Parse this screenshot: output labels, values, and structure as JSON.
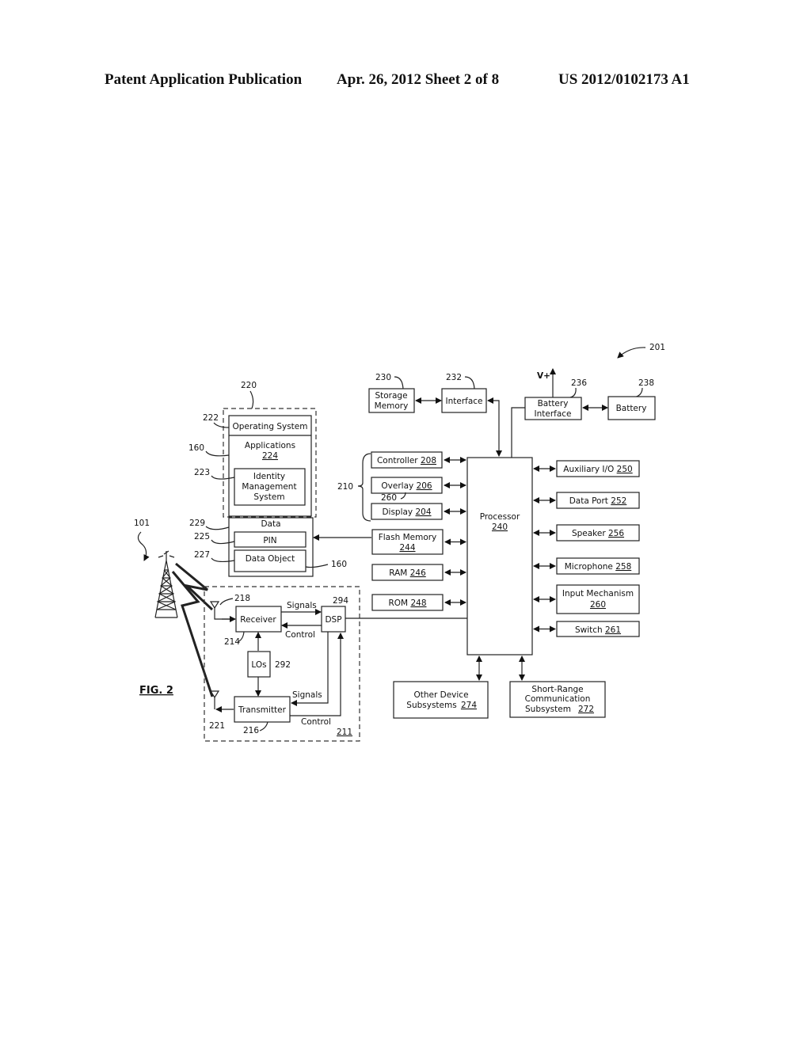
{
  "header": {
    "publication": "Patent Application Publication",
    "date_sheet": "Apr. 26, 2012  Sheet 2 of 8",
    "patent_number": "US 2012/0102173 A1"
  },
  "figure": {
    "label": "FIG. 2",
    "ref_device": "201",
    "ref_network": "101",
    "memory_group": {
      "ref": "220",
      "os": {
        "label": "Operating System",
        "ref": "222"
      },
      "applications": {
        "label": "Applications",
        "num": "224",
        "ref": "160"
      },
      "ims": {
        "line1": "Identity",
        "line2": "Management",
        "line3": "System",
        "ref": "223"
      },
      "data": {
        "label": "Data",
        "ref": "229"
      },
      "pin": {
        "label": "PIN",
        "ref": "225"
      },
      "data_object": {
        "label": "Data Object",
        "ref": "227",
        "ref2": "160"
      }
    },
    "comm": {
      "ref": "211",
      "receiver": {
        "label": "Receiver",
        "ref": "214"
      },
      "transmitter": {
        "label": "Transmitter",
        "ref": "216"
      },
      "dsp": {
        "label": "DSP",
        "ref": "294"
      },
      "los": {
        "label": "LOs",
        "ref": "292"
      },
      "antenna_rx_ref": "218",
      "antenna_tx_ref": "221",
      "signals": "Signals",
      "control": "Control"
    },
    "top": {
      "storage": {
        "line1": "Storage",
        "line2": "Memory",
        "ref": "230"
      },
      "interface": {
        "label": "Interface",
        "ref": "232"
      },
      "vplus": "V+",
      "battery_interface": {
        "line1": "Battery",
        "line2": "Interface",
        "ref": "236"
      },
      "battery": {
        "label": "Battery",
        "ref": "238"
      }
    },
    "left_blocks": {
      "group_ref": "210",
      "overlay_ref": "260",
      "controller": {
        "label": "Controller",
        "num": "208"
      },
      "overlay": {
        "label": "Overlay",
        "num": "206"
      },
      "display": {
        "label": "Display",
        "num": "204"
      },
      "flash": {
        "label": "Flash Memory",
        "num": "244"
      },
      "ram": {
        "label": "RAM",
        "num": "246"
      },
      "rom": {
        "label": "ROM",
        "num": "248"
      }
    },
    "processor": {
      "label": "Processor",
      "num": "240"
    },
    "right_blocks": {
      "aux": {
        "label": "Auxiliary I/O",
        "num": "250"
      },
      "dataport": {
        "label": "Data Port",
        "num": "252"
      },
      "speaker": {
        "label": "Speaker",
        "num": "256"
      },
      "mic": {
        "label": "Microphone",
        "num": "258"
      },
      "input": {
        "label": "Input Mechanism",
        "num": "260"
      },
      "switch": {
        "label": "Switch",
        "num": "261"
      }
    },
    "bottom_blocks": {
      "other": {
        "line1": "Other Device",
        "line2": "Subsystems",
        "num": "274"
      },
      "short": {
        "line1": "Short-Range",
        "line2": "Communication",
        "line3": "Subsystem",
        "num": "272"
      }
    }
  }
}
